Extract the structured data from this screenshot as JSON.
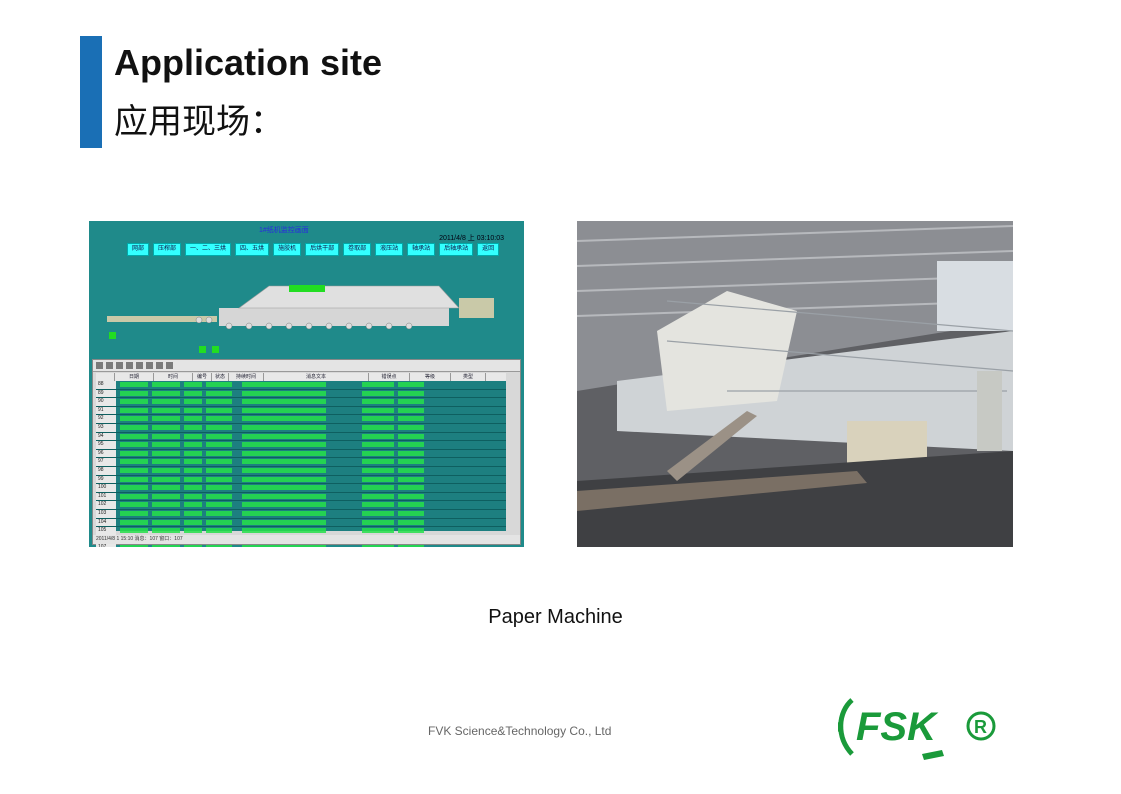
{
  "header": {
    "title_en": "Application site",
    "title_cn": "应用现场："
  },
  "scada": {
    "title": "1#纸机监控画面",
    "clock": "2011/4/8  上 03:10:03",
    "tabs": [
      "网部",
      "压榨部",
      "一、二、三烘",
      "四、五烘",
      "施胶机",
      "后烘干部",
      "卷取部",
      "液压站",
      "轴承站",
      "后轴承站",
      "返回"
    ],
    "table_headers": [
      "日期",
      "时间",
      "编号",
      "状态",
      "持续时间",
      "消息文本",
      "错误点",
      "等级",
      "类型"
    ],
    "row_numbers": [
      "88",
      "89",
      "90",
      "91",
      "92",
      "93",
      "94",
      "95",
      "96",
      "97",
      "98",
      "99",
      "100",
      "101",
      "102",
      "103",
      "104",
      "105",
      "106",
      "107"
    ],
    "status_bar": "2011/4/8     1 15:10 消息：107     窗口：107"
  },
  "caption": "Paper Machine",
  "footer": "FVK Science&Technology Co., Ltd",
  "logo": {
    "text": "FSK",
    "mark": "®",
    "color": "#1a9a3a"
  },
  "colors": {
    "accent": "#1a6fb5",
    "scada_bg": "#1f8a8a"
  }
}
